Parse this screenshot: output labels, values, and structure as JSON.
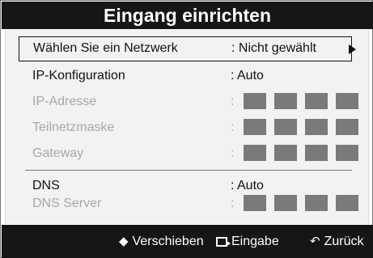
{
  "title": "Eingang einrichten",
  "rows": [
    {
      "label": "Wählen Sie ein Netzwerk",
      "value": ": Nicht gewählt",
      "disabled": false,
      "selected": true
    },
    {
      "label": "IP-Konfiguration",
      "value": ": Auto",
      "disabled": false
    },
    {
      "label": "IP-Adresse",
      "disabled": true,
      "colon": ":"
    },
    {
      "label": "Teilnetzmaske",
      "disabled": true,
      "colon": ":"
    },
    {
      "label": "Gateway",
      "disabled": true,
      "colon": ":"
    },
    {
      "label": "DNS",
      "value": ": Auto",
      "disabled": false
    },
    {
      "label": "DNS Server",
      "disabled": true,
      "colon": ":"
    }
  ],
  "footer": {
    "move_label": "Verschieben",
    "enter_label": "Eingabe",
    "back_label": "Zurück",
    "move_icon": "up-down-arrow-icon",
    "enter_icon": "enter-icon",
    "back_icon": "return-icon"
  },
  "colors": {
    "bar_bg": "#161616",
    "panel_bg": "#f2f2f2",
    "disabled_text": "#a8a8a8",
    "address_block": "#7a7a7a"
  }
}
